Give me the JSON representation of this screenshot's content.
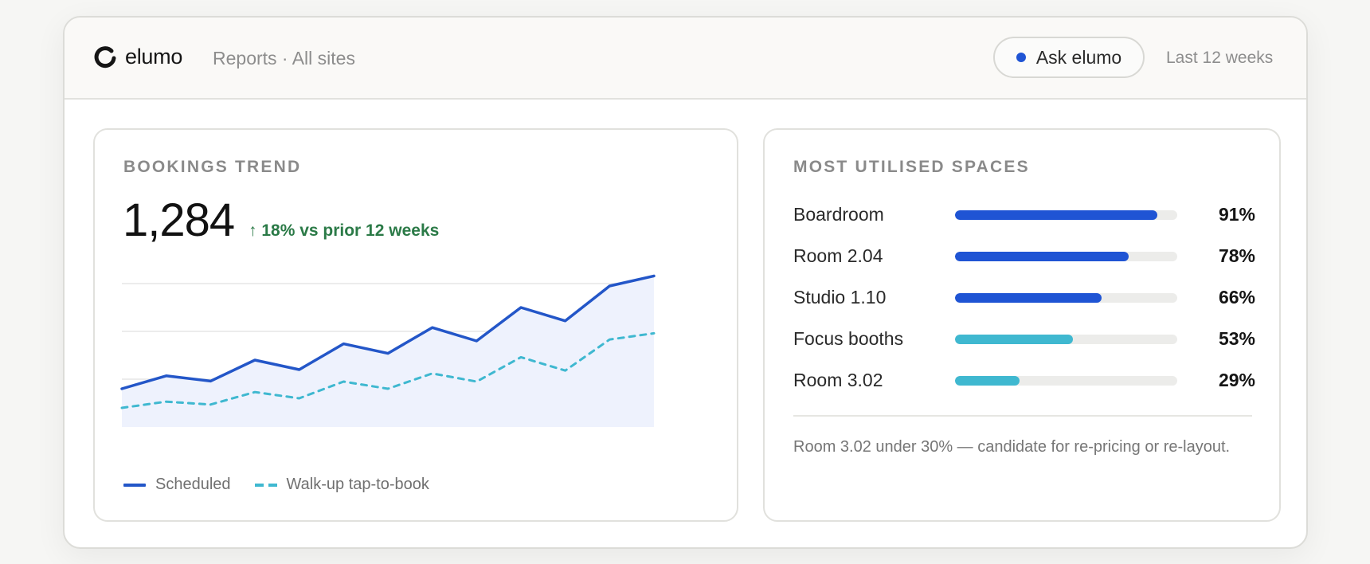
{
  "app": {
    "brand": "elumo",
    "breadcrumb": "Reports · All sites",
    "ask_label": "Ask elumo",
    "range_label": "Last 12 weeks",
    "accent": "#1f54d4"
  },
  "bookings": {
    "title": "BOOKINGS TREND",
    "total": "1,284",
    "delta": "↑ 18% vs prior 12 weeks",
    "legend": [
      {
        "label": "Scheduled",
        "style": "solid",
        "color": "#2356c8"
      },
      {
        "label": "Walk-up tap-to-book",
        "style": "dashed",
        "color": "#3fb8d0"
      }
    ]
  },
  "chart_data": {
    "type": "line",
    "x": [
      1,
      2,
      3,
      4,
      5,
      6,
      7,
      8,
      9,
      10,
      11,
      12,
      13
    ],
    "series": [
      {
        "name": "Scheduled",
        "values": [
          8,
          10.7,
          9.6,
          14,
          12,
          17.4,
          15.4,
          20.8,
          18,
          25,
          22.2,
          29.5,
          31.6
        ],
        "color": "#2356c8",
        "style": "solid"
      },
      {
        "name": "Walk-up tap-to-book",
        "values": [
          4,
          5.3,
          4.7,
          7.3,
          6,
          9.5,
          8,
          11.2,
          9.5,
          14.6,
          11.8,
          18.3,
          19.6
        ],
        "color": "#3fb8d0",
        "style": "dashed"
      }
    ],
    "ylim": [
      0,
      30
    ],
    "grid": true,
    "legend": "bottom-left",
    "area_fill": "Scheduled"
  },
  "spaces": {
    "title": "MOST UTILISED SPACES",
    "items": [
      {
        "name": "Boardroom",
        "pct": 91,
        "label": "91%",
        "color": "#1f54d4"
      },
      {
        "name": "Room 2.04",
        "pct": 78,
        "label": "78%",
        "color": "#1f54d4"
      },
      {
        "name": "Studio 1.10",
        "pct": 66,
        "label": "66%",
        "color": "#1f54d4"
      },
      {
        "name": "Focus booths",
        "pct": 53,
        "label": "53%",
        "color": "#3fb8d0"
      },
      {
        "name": "Room 3.02",
        "pct": 29,
        "label": "29%",
        "color": "#3fb8d0"
      }
    ],
    "note": "Room 3.02 under 30% — candidate for re-pricing or re-layout."
  }
}
